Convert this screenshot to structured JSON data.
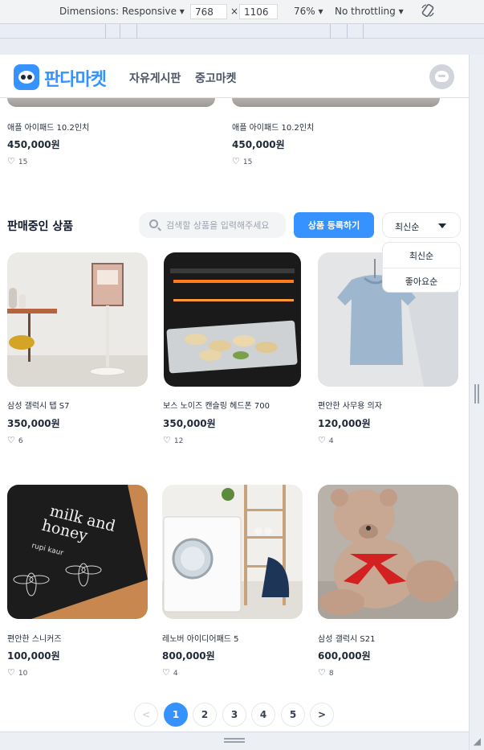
{
  "devtools": {
    "dimensions_label": "Dimensions: Responsive",
    "width_value": "768",
    "times": "×",
    "height_value": "1106",
    "zoom": "76%",
    "throttling": "No throttling"
  },
  "header": {
    "brand": "판다마켓",
    "nav": [
      "자유게시판",
      "중고마켓"
    ]
  },
  "best_products": [
    {
      "name": "애플 아이패드 10.2인치",
      "price": "450,000원",
      "likes": "15"
    },
    {
      "name": "애플 아이패드 10.2인치",
      "price": "450,000원",
      "likes": "15"
    }
  ],
  "onsale": {
    "title": "판매중인 상품",
    "search_placeholder": "검색할 상품을 입력해주세요",
    "register_label": "상품 등록하기",
    "sort_selected": "최신순",
    "sort_options": [
      "최신순",
      "좋아요순"
    ]
  },
  "products": [
    {
      "name": "삼성 갤럭시 탭 S7",
      "price": "350,000원",
      "likes": "6"
    },
    {
      "name": "보스 노이즈 캔슬링 헤드폰 700",
      "price": "350,000원",
      "likes": "12"
    },
    {
      "name": "편안한 사무용 의자",
      "price": "120,000원",
      "likes": "4"
    },
    {
      "name": "편안한 스니커즈",
      "price": "100,000원",
      "likes": "10"
    },
    {
      "name": "레노버 아이디어패드 5",
      "price": "800,000원",
      "likes": "4"
    },
    {
      "name": "삼성 갤럭시 S21",
      "price": "600,000원",
      "likes": "8"
    }
  ],
  "book_text": {
    "title": "milk and honey",
    "author": "rupi kaur"
  },
  "pagination": {
    "prev": "<",
    "pages": [
      "1",
      "2",
      "3",
      "4",
      "5"
    ],
    "next": ">",
    "current": "1"
  },
  "colors": {
    "primary": "#3692ff",
    "text": "#1f2937",
    "muted": "#9ca3af"
  }
}
